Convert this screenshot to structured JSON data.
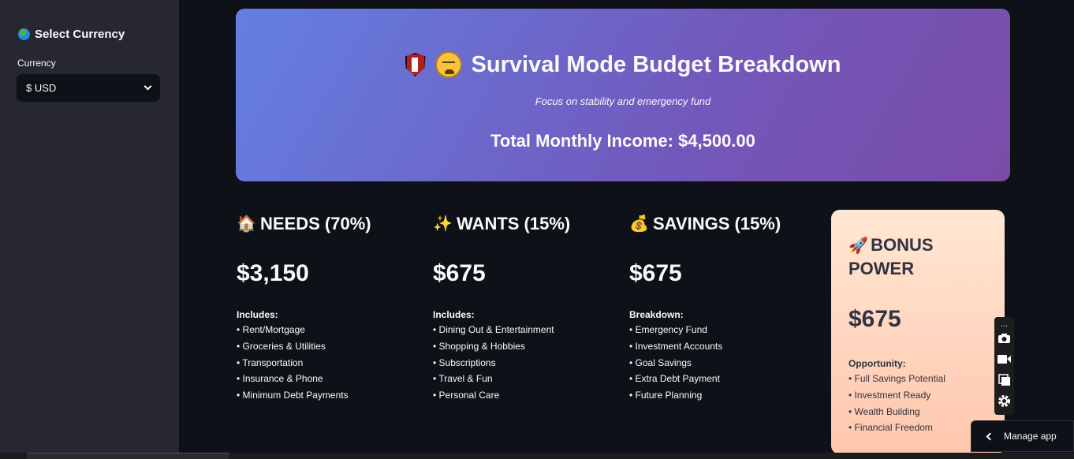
{
  "sidebar": {
    "title": "Select Currency",
    "currency_label": "Currency",
    "currency_value": "$ USD"
  },
  "hero": {
    "title": "Survival Mode Budget Breakdown",
    "subtitle": "Focus on stability and emergency fund",
    "income": "Total Monthly Income: $4,500.00",
    "gradient_start": "#6380e2",
    "gradient_end": "#7a4ca7"
  },
  "columns": [
    {
      "icon": "house-icon",
      "heading": "NEEDS (70%)",
      "amount": "$3,150",
      "sub": "Includes:",
      "items": [
        "• Rent/Mortgage",
        "• Groceries & Utilities",
        "• Transportation",
        "• Insurance & Phone",
        "• Minimum Debt Payments"
      ]
    },
    {
      "icon": "sparkles-icon",
      "heading": "WANTS (15%)",
      "amount": "$675",
      "sub": "Includes:",
      "items": [
        "• Dining Out & Entertainment",
        "• Shopping & Hobbies",
        "• Subscriptions",
        "• Travel & Fun",
        "• Personal Care"
      ]
    },
    {
      "icon": "money-bag-icon",
      "heading": "SAVINGS (15%)",
      "amount": "$675",
      "sub": "Breakdown:",
      "items": [
        "• Emergency Fund",
        "• Investment Accounts",
        "• Goal Savings",
        "• Extra Debt Payment",
        "• Future Planning"
      ]
    }
  ],
  "bonus": {
    "icon": "rocket-icon",
    "heading_line1": "BONUS",
    "heading_line2": "POWER",
    "amount": "$675",
    "sub": "Opportunity:",
    "items": [
      "• Full Savings Potential",
      "• Investment Ready",
      "• Wealth Building",
      "• Financial Freedom"
    ]
  },
  "manage": {
    "label": "Manage app"
  }
}
